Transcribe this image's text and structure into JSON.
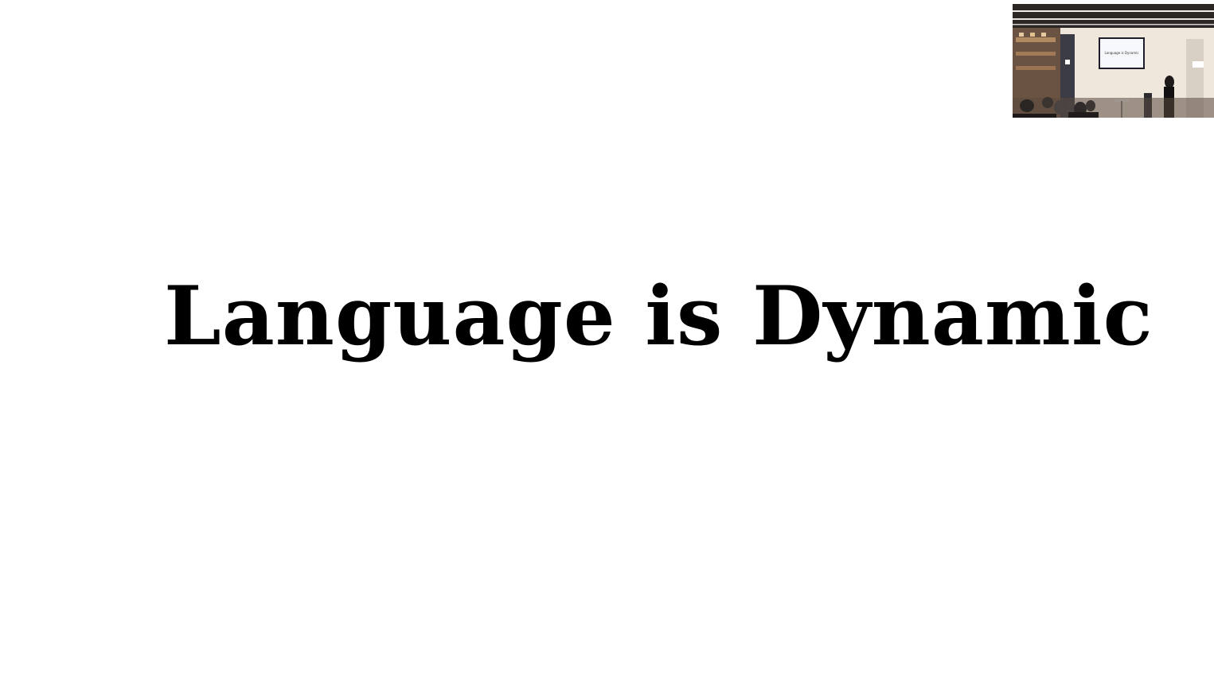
{
  "slide": {
    "title": "Language is Dynamic"
  },
  "camera_preview": {
    "screen_text": "Language is Dynamic"
  }
}
